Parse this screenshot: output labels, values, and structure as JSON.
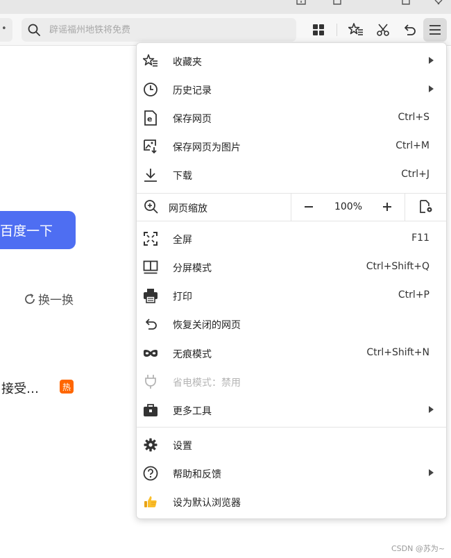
{
  "toolbar": {
    "search_placeholder": "辟谣福州地铁将免费"
  },
  "page": {
    "search_button": "百度一下",
    "refresh_label": "换一换",
    "hot_item": "接受…",
    "hot_badge": "热",
    "watermark": "CSDN @苏为~"
  },
  "menu": {
    "items_top": [
      {
        "label": "收藏夹",
        "icon": "favorites-star-list-icon",
        "submenu": true
      },
      {
        "label": "历史记录",
        "icon": "history-clock-icon",
        "submenu": true
      },
      {
        "label": "保存网页",
        "icon": "save-page-icon",
        "shortcut": "Ctrl+S"
      },
      {
        "label": "保存网页为图片",
        "icon": "save-page-image-icon",
        "shortcut": "Ctrl+M"
      },
      {
        "label": "下载",
        "icon": "download-icon",
        "shortcut": "Ctrl+J"
      }
    ],
    "zoom": {
      "label": "网页缩放",
      "value": "100%",
      "minus": "−",
      "plus": "+"
    },
    "items_mid": [
      {
        "label": "全屏",
        "icon": "fullscreen-icon",
        "shortcut": "F11"
      },
      {
        "label": "分屏模式",
        "icon": "split-screen-icon",
        "shortcut": "Ctrl+Shift+Q"
      },
      {
        "label": "打印",
        "icon": "printer-icon",
        "shortcut": "Ctrl+P"
      },
      {
        "label": "恢复关闭的网页",
        "icon": "undo-icon"
      },
      {
        "label": "无痕模式",
        "icon": "incognito-mask-icon",
        "shortcut": "Ctrl+Shift+N"
      },
      {
        "label": "省电模式：禁用",
        "icon": "power-plug-icon",
        "disabled": true
      },
      {
        "label": "更多工具",
        "icon": "toolbox-icon",
        "submenu": true
      }
    ],
    "items_bottom": [
      {
        "label": "设置",
        "icon": "gear-icon"
      },
      {
        "label": "帮助和反馈",
        "icon": "help-circle-icon",
        "submenu": true
      },
      {
        "label": "设为默认浏览器",
        "icon": "thumbs-up-icon"
      }
    ]
  }
}
